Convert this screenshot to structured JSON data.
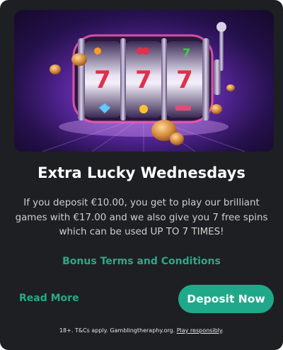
{
  "promo": {
    "title": "Extra Lucky Wednesdays",
    "description": "If you deposit €10.00, you get to play our brilliant games with €17.00 and we also give you 7 free spins which can be used UP TO 7 TIMES!",
    "terms_link": "Bonus Terms and Conditions",
    "read_more": "Read More",
    "deposit_button": "Deposit Now",
    "footer": {
      "prefix": "18+. T&Cs apply. Gamblingtheraphy.org.",
      "link": "Play responsibly",
      "suffix": "."
    }
  },
  "hero_image": {
    "subject": "slot machine reels with cherries and lucky 7, spinning gold coins",
    "reel_symbols": [
      "7",
      "7",
      "7"
    ]
  },
  "colors": {
    "card_background": "#1e1f22",
    "accent": "#1fa98a",
    "link": "#2aa88a",
    "title": "#ffffff",
    "body_text": "#cfcfcf"
  }
}
